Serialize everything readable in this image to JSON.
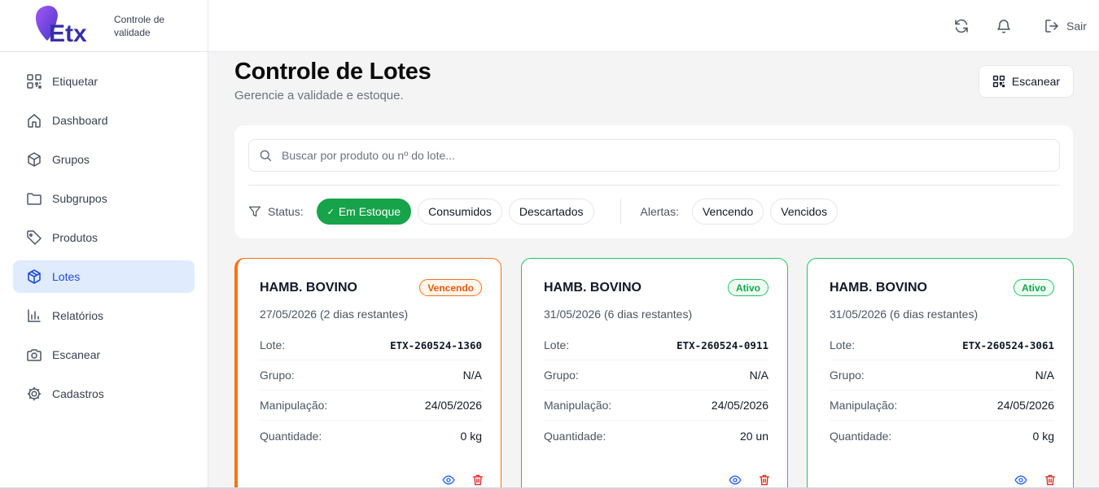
{
  "brand": {
    "logo_text": "Etx",
    "subtitle": "Controle de validade"
  },
  "sidebar": {
    "items": [
      {
        "label": "Etiquetar",
        "icon": "qr-code-icon"
      },
      {
        "label": "Dashboard",
        "icon": "home-icon"
      },
      {
        "label": "Grupos",
        "icon": "box-icon"
      },
      {
        "label": "Subgrupos",
        "icon": "folder-icon"
      },
      {
        "label": "Produtos",
        "icon": "tag-icon"
      },
      {
        "label": "Lotes",
        "icon": "package-icon",
        "active": true
      },
      {
        "label": "Relatórios",
        "icon": "bar-chart-icon"
      },
      {
        "label": "Escanear",
        "icon": "camera-icon"
      },
      {
        "label": "Cadastros",
        "icon": "gear-icon"
      }
    ]
  },
  "topbar": {
    "logout_label": "Sair"
  },
  "page": {
    "title": "Controle de Lotes",
    "subtitle": "Gerencie a validade e estoque.",
    "scan_label": "Escanear"
  },
  "search": {
    "placeholder": "Buscar por produto ou nº do lote...",
    "value": ""
  },
  "filters": {
    "status_label": "Status:",
    "status_options": [
      "Em Estoque",
      "Consumidos",
      "Descartados"
    ],
    "selected": "Em Estoque",
    "alerts_label": "Alertas:",
    "alert_options": [
      "Vencendo",
      "Vencidos"
    ]
  },
  "field_labels": {
    "lot": "Lote:",
    "group": "Grupo:",
    "handling": "Manipulação:",
    "quantity": "Quantidade:"
  },
  "lots": [
    {
      "name": "HAMB. BOVINO",
      "badge": "Vencendo",
      "date": "27/05/2026 (2 dias restantes)",
      "lot": "ETX-260524-1360",
      "group": "N/A",
      "handling": "24/05/2026",
      "quantity": "0 kg"
    },
    {
      "name": "HAMB. BOVINO",
      "badge": "Ativo",
      "date": "31/05/2026 (6 dias restantes)",
      "lot": "ETX-260524-0911",
      "group": "N/A",
      "handling": "24/05/2026",
      "quantity": "20 un"
    },
    {
      "name": "HAMB. BOVINO",
      "badge": "Ativo",
      "date": "31/05/2026 (6 dias restantes)",
      "lot": "ETX-260524-3061",
      "group": "N/A",
      "handling": "24/05/2026",
      "quantity": "0 kg"
    }
  ],
  "colors": {
    "primary": "#16a34a",
    "warning": "#f97316",
    "active_nav_bg": "#e0ebfd",
    "active_nav_text": "#1d4ed8"
  }
}
